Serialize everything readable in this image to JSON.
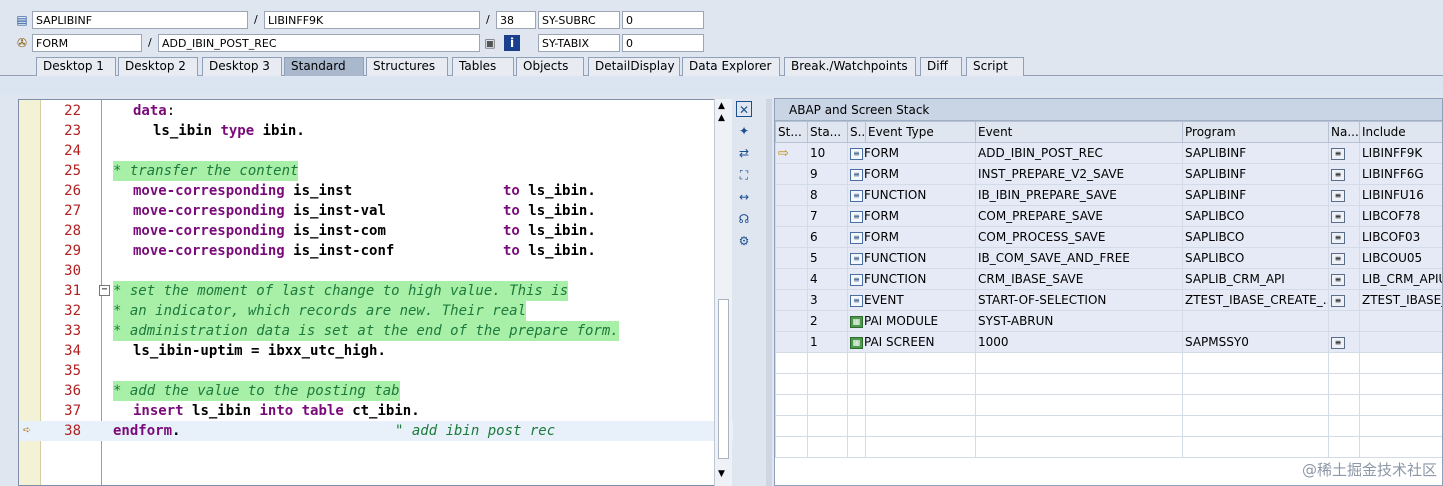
{
  "header": {
    "row1": {
      "program": "SAPLIBINF",
      "include": "LIBINFF9K",
      "line": "38",
      "var_name": "SY-SUBRC",
      "var_value": "0"
    },
    "row2": {
      "type": "FORM",
      "name": "ADD_IBIN_POST_REC",
      "var_name": "SY-TABIX",
      "var_value": "0"
    },
    "slash": "/"
  },
  "tabs": [
    "Desktop 1",
    "Desktop 2",
    "Desktop 3",
    "Standard",
    "Structures",
    "Tables",
    "Objects",
    "DetailDisplay",
    "Data Explorer",
    "Break./Watchpoints",
    "Diff",
    "Script"
  ],
  "active_tab": "Standard",
  "code": {
    "line_numbers": [
      "22",
      "23",
      "24",
      "25",
      "26",
      "27",
      "28",
      "29",
      "30",
      "31",
      "32",
      "33",
      "34",
      "35",
      "36",
      "37",
      "38"
    ],
    "lines": {
      "l22_kw": "data",
      "l22_p": ":",
      "l23_id": "ls_ibin",
      "l23_kw": "type",
      "l23_id2": "ibin",
      "l23_p": ".",
      "l25_cmt": "* transfer the content",
      "l26_kw": "move-corresponding",
      "l26_a": "is_inst",
      "l26_to": "to",
      "l26_b": "ls_ibin",
      "l27_kw": "move-corresponding",
      "l27_a": "is_inst-val",
      "l27_to": "to",
      "l27_b": "ls_ibin",
      "l28_kw": "move-corresponding",
      "l28_a": "is_inst-com",
      "l28_to": "to",
      "l28_b": "ls_ibin",
      "l29_kw": "move-corresponding",
      "l29_a": "is_inst-conf",
      "l29_to": "to",
      "l29_b": "ls_ibin",
      "l31_cmt": "* set the moment of last change to high value. This is",
      "l32_cmt": "* an indicator, which records are new. Their real",
      "l33_cmt": "* administration data is set at the end of the prepare form.",
      "l34_a": "ls_ibin-uptim",
      "l34_eq": "=",
      "l34_b": "ibxx_utc_high",
      "l36_cmt": "* add the value to the posting tab",
      "l37_kw": "insert",
      "l37_a": "ls_ibin",
      "l37_kw2": "into table",
      "l37_b": "ct_ibin",
      "l38_kw": "endform",
      "l38_str": "\" add ibin post rec",
      "dot": "."
    }
  },
  "stack": {
    "title": "ABAP and Screen Stack",
    "columns": [
      "St...",
      "Sta...",
      "S...",
      "Event Type",
      "Event",
      "Program",
      "Na...",
      "Include"
    ],
    "rows": [
      {
        "num": "10",
        "type_icon": "form-icon",
        "type": "FORM",
        "event": "ADD_IBIN_POST_REC",
        "program": "SAPLIBINF",
        "include": "LIBINFF9K",
        "current": true
      },
      {
        "num": "9",
        "type_icon": "form-icon",
        "type": "FORM",
        "event": "INST_PREPARE_V2_SAVE",
        "program": "SAPLIBINF",
        "include": "LIBINFF6G",
        "current": false
      },
      {
        "num": "8",
        "type_icon": "form-icon",
        "type": "FUNCTION",
        "event": "IB_IBIN_PREPARE_SAVE",
        "program": "SAPLIBINF",
        "include": "LIBINFU16",
        "current": false
      },
      {
        "num": "7",
        "type_icon": "form-icon",
        "type": "FORM",
        "event": "COM_PREPARE_SAVE",
        "program": "SAPLIBCO",
        "include": "LIBCOF78",
        "current": false
      },
      {
        "num": "6",
        "type_icon": "form-icon",
        "type": "FORM",
        "event": "COM_PROCESS_SAVE",
        "program": "SAPLIBCO",
        "include": "LIBCOF03",
        "current": false
      },
      {
        "num": "5",
        "type_icon": "form-icon",
        "type": "FUNCTION",
        "event": "IB_COM_SAVE_AND_FREE",
        "program": "SAPLIBCO",
        "include": "LIBCOU05",
        "current": false
      },
      {
        "num": "4",
        "type_icon": "form-icon",
        "type": "FUNCTION",
        "event": "CRM_IBASE_SAVE",
        "program": "SAPLIB_CRM_API",
        "include": "LIB_CRM_APIU",
        "current": false
      },
      {
        "num": "3",
        "type_icon": "form-icon",
        "type": "EVENT",
        "event": "START-OF-SELECTION",
        "program": "ZTEST_IBASE_CREATE_...",
        "include": "ZTEST_IBASE_",
        "current": false
      },
      {
        "num": "2",
        "type_icon": "pai-icon",
        "type": "PAI MODULE",
        "event": "SYST-ABRUN",
        "program": "",
        "include": "",
        "current": false
      },
      {
        "num": "1",
        "type_icon": "pai-icon",
        "type": "PAI SCREEN",
        "event": "1000",
        "program": "SAPMSSY0",
        "include": "",
        "current": false
      }
    ]
  },
  "watermark": "@稀土掘金技术社区",
  "colors": {
    "comment_bg": "#a8f0a8",
    "keyword": "#7a0a7a",
    "line_number": "#b02020",
    "active_tab": "#a9b8cc"
  }
}
